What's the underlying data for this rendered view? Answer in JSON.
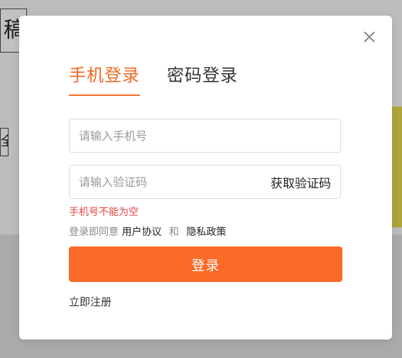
{
  "background": {
    "box1_text": "稿",
    "box2_text": "全"
  },
  "modal": {
    "close_icon": "close-icon",
    "tabs": [
      {
        "label": "手机登录",
        "active": true
      },
      {
        "label": "密码登录",
        "active": false
      }
    ],
    "phone": {
      "placeholder": "请输入手机号",
      "value": ""
    },
    "code": {
      "placeholder": "请输入验证码",
      "value": "",
      "get_code_label": "获取验证码"
    },
    "error": "手机号不能为空",
    "agreement": {
      "prefix": "登录即同意",
      "user_agreement": "用户协议",
      "and": "和",
      "privacy_policy": "隐私政策"
    },
    "login_label": "登录",
    "register_label": "立即注册"
  },
  "colors": {
    "accent": "#f26a24",
    "button": "#fb6a27",
    "error": "#e64545"
  }
}
